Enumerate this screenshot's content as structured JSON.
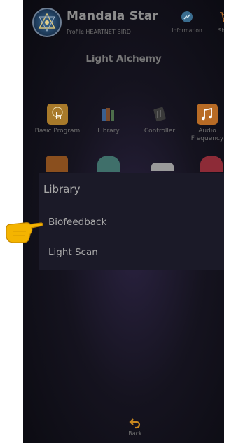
{
  "header": {
    "app_title": "Mandala Star",
    "profile_label": "Profile HEARTNET BIRD",
    "information_label": "Information",
    "shop_label": "Shop"
  },
  "section_title": "Light Alchemy",
  "tiles": [
    {
      "label": "Basic Program",
      "icon": "touch-hand-icon"
    },
    {
      "label": "Library",
      "icon": "books-icon"
    },
    {
      "label": "Controller",
      "icon": "controller-icon"
    },
    {
      "label": "Audio Frequency",
      "icon": "music-note-icon"
    }
  ],
  "dialog": {
    "title": "Library",
    "options": [
      "Biofeedback",
      "Light Scan"
    ]
  },
  "footer": {
    "back_label": "Back"
  },
  "colors": {
    "background": "#0a0a10",
    "dialog": "#1b1a28",
    "accent_orange": "#b86b25",
    "hand_yellow": "#f4b400"
  }
}
